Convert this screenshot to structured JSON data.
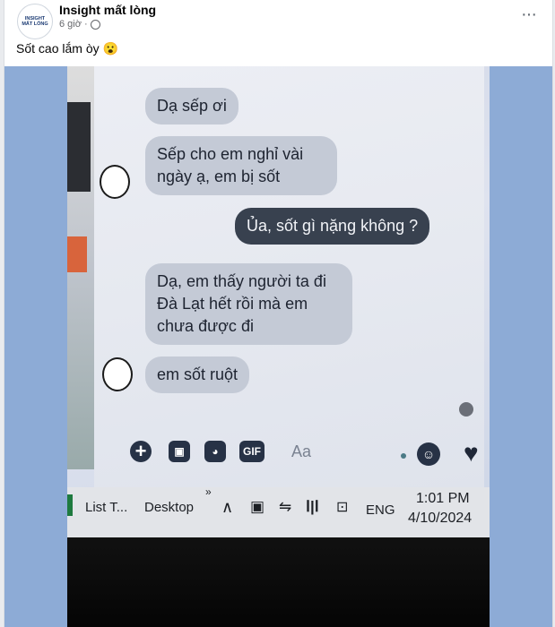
{
  "post": {
    "page_name": "Insight mất lòng",
    "time": "6 giờ ·",
    "caption": "Sốt cao lắm òy 😮",
    "avatar_line1": "INSIGHT",
    "avatar_line2": "MẤT LÒNG",
    "more_label": "···"
  },
  "chat": {
    "messages": [
      {
        "text": "Dạ sếp ơi"
      },
      {
        "text": "Sếp cho em nghỉ vài ngày ạ, em bị sốt"
      },
      {
        "text": "Ủa, sốt gì nặng không ?"
      },
      {
        "text": "Dạ, em thấy người ta đi Đà Lạt hết rồi mà em chưa được đi"
      },
      {
        "text": "em sốt ruột"
      }
    ],
    "input_placeholder": "Aa",
    "gif_label": "GIF",
    "plus_label": "+"
  },
  "taskbar": {
    "item1": "List T...",
    "item2": "Desktop",
    "chevron": "»",
    "lang": "ENG",
    "time": "1:01 PM",
    "date": "4/10/2024"
  }
}
